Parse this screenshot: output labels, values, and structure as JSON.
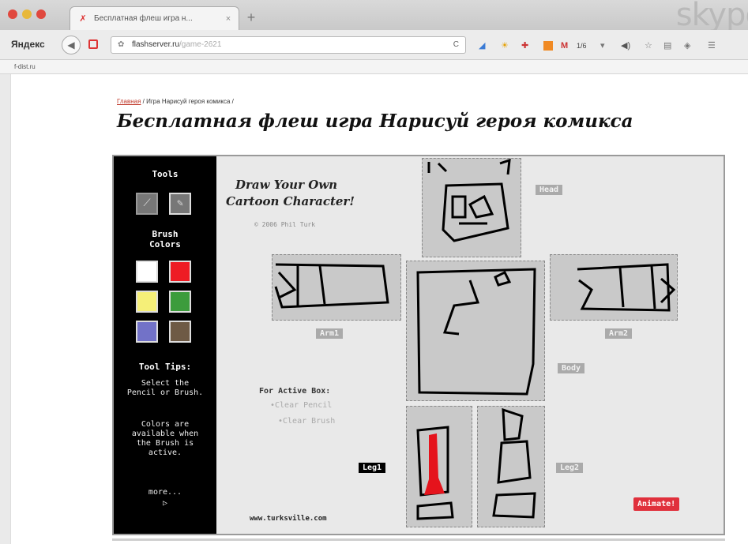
{
  "browser": {
    "tab_title": "Бесплатная флеш игра н...",
    "tab_close": "×",
    "new_tab": "+",
    "watermark": "skype",
    "search_brand": "Яндекс",
    "url_host": "flashserver.ru",
    "url_path": "/game-2621",
    "extensions": {
      "mail_label": "M",
      "mail_count": "1/6",
      "dropdown": "▾"
    },
    "bookmark": "f-dist.ru"
  },
  "page": {
    "breadcrumb_home": "Главная",
    "breadcrumb_rest": " / Игра Нарисуй героя комикса /",
    "title": "Бесплатная флеш игра Нарисуй героя комикса"
  },
  "game": {
    "tools_heading": "Tools",
    "brush_colors_heading": "Brush Colors",
    "colors": [
      "#ffffff",
      "#ee1c24",
      "#f5ef78",
      "#3c9c3c",
      "#7272c8",
      "#6e5a45"
    ],
    "tool_tips_heading": "Tool Tips:",
    "tip_1": "Select the Pencil or Brush.",
    "tip_2": "Colors are available when the Brush is active.",
    "more": "more...",
    "more_arrow": "▷",
    "title_line1": "Draw Your Own",
    "title_line2": "Cartoon Character!",
    "copyright": "© 2006 Phil Turk",
    "labels": {
      "head": "Head",
      "arm1": "Arm1",
      "arm2": "Arm2",
      "body": "Body",
      "leg1": "Leg1",
      "leg2": "Leg2"
    },
    "active_box": "For Active Box:",
    "clear_pencil": "•Clear Pencil",
    "clear_brush": "•Clear Brush",
    "website": "www.turksville.com",
    "animate": "Animate!"
  }
}
